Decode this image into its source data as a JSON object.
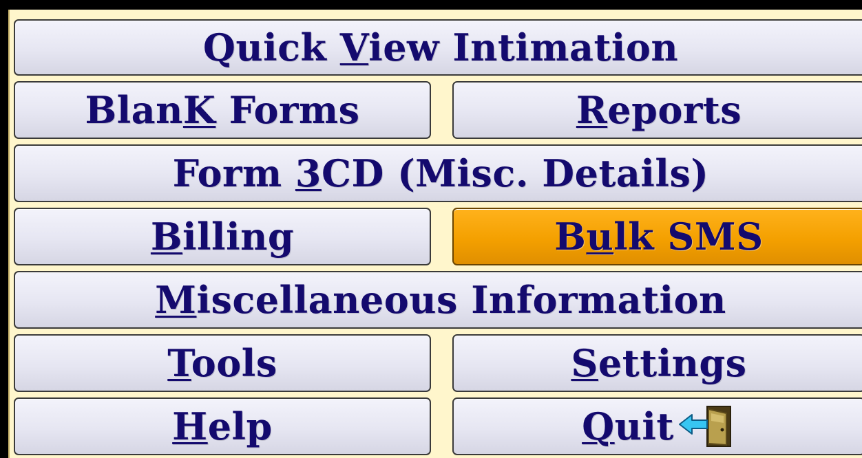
{
  "menu": {
    "quick_view": {
      "before": "Quick ",
      "hotkey": "V",
      "after": "iew Intimation"
    },
    "blank_forms": {
      "before": "Blan",
      "hotkey": "K",
      "after": " Forms"
    },
    "reports": {
      "before": "",
      "hotkey": "R",
      "after": "eports"
    },
    "form3cd": {
      "before": "Form ",
      "hotkey": "3",
      "after": "CD (Misc. Details)"
    },
    "billing": {
      "before": "",
      "hotkey": "B",
      "after": "illing"
    },
    "bulk_sms": {
      "before": "B",
      "hotkey": "u",
      "after": "lk SMS"
    },
    "misc_info": {
      "before": "",
      "hotkey": "M",
      "after": "iscellaneous Information"
    },
    "tools": {
      "before": "",
      "hotkey": "T",
      "after": "ools"
    },
    "settings": {
      "before": "",
      "hotkey": "S",
      "after": "ettings"
    },
    "help": {
      "before": "",
      "hotkey": "H",
      "after": "elp"
    },
    "quit": {
      "before": "",
      "hotkey": "Q",
      "after": "uit",
      "icon": "exit-door-icon"
    }
  },
  "colors": {
    "panel_bg": "#fff6cc",
    "button_text": "#140a6e",
    "active_button": "#f4a000"
  },
  "active_item": "bulk_sms"
}
